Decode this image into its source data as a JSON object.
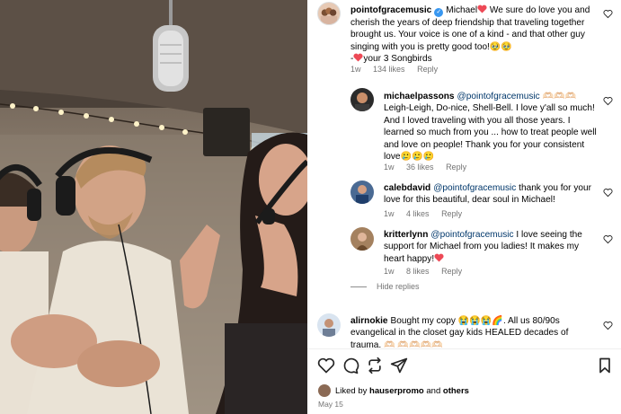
{
  "colors": {
    "link": "#00376b",
    "meta": "#737373",
    "verified": "#3897f0",
    "heart": "#ed4956"
  },
  "post": {
    "caption": {
      "username": "pointofgracemusic",
      "text_1": "Michael",
      "text_2": " We sure do love you and cherish the years of deep friendship that traveling together brought us. Your voice is one of a kind - and that other guy singing with you is pretty good too!🥹🥹",
      "text_3": "-",
      "text_4": "your 3 Songbirds",
      "age": "1w",
      "likes": "134 likes",
      "reply": "Reply"
    },
    "comments": [
      {
        "username": "michaelpassons",
        "text": "@pointofgracemusic 🫶🏻🫶🏻🫶🏻 Leigh-Leigh, Do-nice, Shell-Bell. I love y'all so much! And I loved traveling with you all those years. I learned so much from you ... how to treat people well and love on people! Thank you for your consistent love🥲🥲🥲",
        "mention": "@pointofgracemusic",
        "body": " 🫶🏻🫶🏻🫶🏻 Leigh-Leigh, Do-nice, Shell-Bell. I love y'all so much! And I loved traveling with you all those years. I learned so much from you ... how to treat people well and love on people! Thank you for your consistent love🥲🥲🥲",
        "age": "1w",
        "likes": "36 likes",
        "reply": "Reply"
      },
      {
        "username": "calebdavid",
        "mention": "@pointofgracemusic",
        "body": " thank you for your love for this beautiful, dear soul in Michael!",
        "age": "1w",
        "likes": "4 likes",
        "reply": "Reply"
      },
      {
        "username": "kritterlynn",
        "mention": "@pointofgracemusic",
        "body": " I love seeing the support for Michael from you ladies! It makes my heart happy!",
        "age": "1w",
        "likes": "8 likes",
        "reply": "Reply"
      },
      {
        "username": "alirnokie",
        "body": "Bought my copy 😭😭😭🌈. All us 80/90s evangelical in the closet gay kids HEALED decades of trauma. 🫶🏻 🫶🏻🫶🏻🫶🏻🫶🏻"
      }
    ],
    "hide_replies": "Hide replies",
    "liked_by_prefix": "Liked by",
    "liked_by_user": "hauserpromo",
    "liked_by_and": "and",
    "liked_by_others": "others",
    "date": "May 15"
  }
}
